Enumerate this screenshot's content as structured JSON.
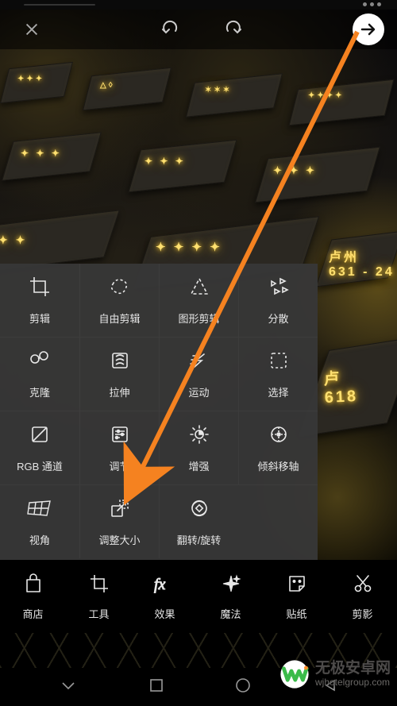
{
  "top_bar": {
    "close_icon": "close",
    "undo_icon": "undo",
    "redo_icon": "redo",
    "forward_icon": "chevron-right"
  },
  "tool_grid": {
    "rows": [
      [
        {
          "icon": "crop",
          "label": "剪辑"
        },
        {
          "icon": "free-crop",
          "label": "自由剪辑"
        },
        {
          "icon": "shape-crop",
          "label": "图形剪辑"
        },
        {
          "icon": "scatter",
          "label": "分散"
        }
      ],
      [
        {
          "icon": "clone",
          "label": "克隆"
        },
        {
          "icon": "stretch",
          "label": "拉伸"
        },
        {
          "icon": "motion",
          "label": "运动"
        },
        {
          "icon": "select",
          "label": "选择"
        }
      ],
      [
        {
          "icon": "rgb",
          "label": "RGB 通道"
        },
        {
          "icon": "adjust",
          "label": "调节"
        },
        {
          "icon": "enhance",
          "label": "增强"
        },
        {
          "icon": "tilt",
          "label": "倾斜移轴"
        }
      ],
      [
        {
          "icon": "perspective",
          "label": "视角"
        },
        {
          "icon": "resize",
          "label": "调整大小"
        },
        {
          "icon": "rotate",
          "label": "翻转/旋转"
        },
        null
      ]
    ]
  },
  "bottom_bar": {
    "items": [
      {
        "icon": "store",
        "label": "商店",
        "active": false
      },
      {
        "icon": "crop-tool",
        "label": "工具",
        "active": true
      },
      {
        "icon": "fx",
        "label": "效果",
        "active": false
      },
      {
        "icon": "magic",
        "label": "魔法",
        "active": false
      },
      {
        "icon": "sticker",
        "label": "贴纸",
        "active": false
      },
      {
        "icon": "scissors",
        "label": "剪影",
        "active": false
      }
    ]
  },
  "watermark": {
    "line1": "无极安卓网",
    "line2": "wjhotelgroup.com"
  }
}
